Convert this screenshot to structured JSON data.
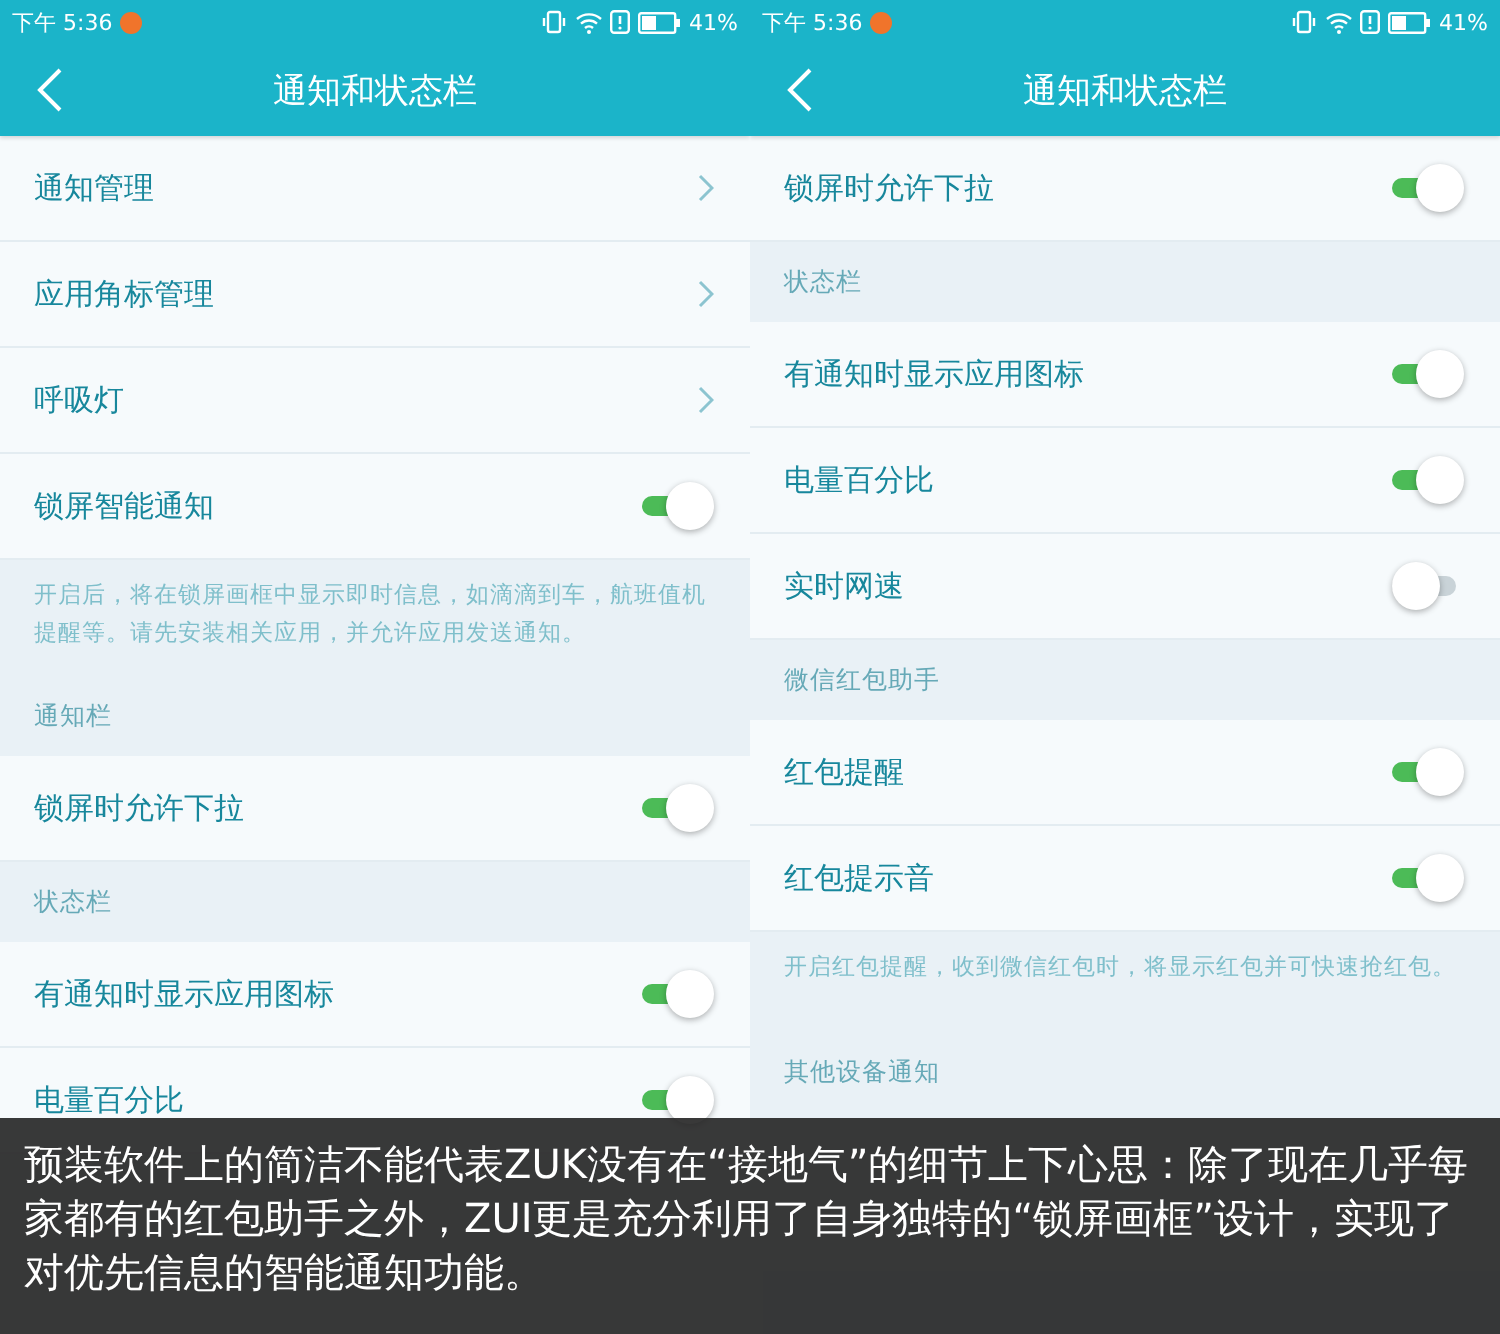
{
  "panels": [
    {
      "status": {
        "time": "下午 5:36",
        "battery": "41%"
      },
      "title": "通知和状态栏",
      "items": [
        {
          "kind": "link",
          "label": "通知管理"
        },
        {
          "kind": "link",
          "label": "应用角标管理"
        },
        {
          "kind": "link",
          "label": "呼吸灯"
        },
        {
          "kind": "toggle",
          "label": "锁屏智能通知",
          "on": true
        },
        {
          "kind": "hint",
          "text": "开启后，将在锁屏画框中显示即时信息，如滴滴到车，航班值机提醒等。请先安装相关应用，并允许应用发送通知。"
        },
        {
          "kind": "section",
          "label": "通知栏"
        },
        {
          "kind": "toggle",
          "label": "锁屏时允许下拉",
          "on": true
        },
        {
          "kind": "section",
          "label": "状态栏"
        },
        {
          "kind": "toggle",
          "label": "有通知时显示应用图标",
          "on": true
        },
        {
          "kind": "toggle",
          "label": "电量百分比",
          "on": true
        }
      ]
    },
    {
      "status": {
        "time": "下午 5:36",
        "battery": "41%"
      },
      "title": "通知和状态栏",
      "items": [
        {
          "kind": "toggle",
          "label": "锁屏时允许下拉",
          "on": true
        },
        {
          "kind": "section",
          "label": "状态栏"
        },
        {
          "kind": "toggle",
          "label": "有通知时显示应用图标",
          "on": true
        },
        {
          "kind": "toggle",
          "label": "电量百分比",
          "on": true
        },
        {
          "kind": "toggle",
          "label": "实时网速",
          "on": false
        },
        {
          "kind": "section",
          "label": "微信红包助手"
        },
        {
          "kind": "toggle",
          "label": "红包提醒",
          "on": true
        },
        {
          "kind": "toggle",
          "label": "红包提示音",
          "on": true
        },
        {
          "kind": "hint",
          "text": "开启红包提醒，收到微信红包时，将显示红包并可快速抢红包。"
        },
        {
          "kind": "section",
          "label": "其他设备通知"
        }
      ]
    }
  ],
  "caption": "预装软件上的简洁不能代表ZUK没有在“接地气”的细节上下心思：除了现在几乎每家都有的红包助手之外，ZUI更是充分利用了自身独特的“锁屏画框”设计，实现了对优先信息的智能通知功能。"
}
